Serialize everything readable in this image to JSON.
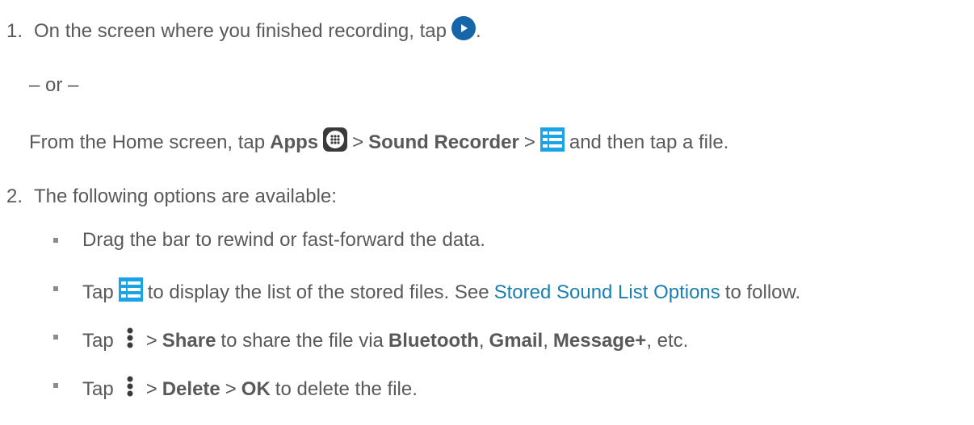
{
  "step1": {
    "number": "1.",
    "text_before": "On the screen where you finished recording, tap",
    "text_after": ".",
    "play_icon": "play-icon",
    "or_text": "– or –",
    "alt": {
      "t1": "From the Home screen, tap",
      "apps": "Apps",
      "sep1": ">",
      "sound_recorder": "Sound Recorder",
      "sep2": ">",
      "t2": "and then tap a file.",
      "apps_icon": "apps-grid-icon",
      "list_icon": "list-icon"
    }
  },
  "step2": {
    "number": "2.",
    "text": "The following options are available:",
    "bullets": [
      {
        "text": "Drag the bar to rewind or fast-forward the data."
      },
      {
        "t1": "Tap",
        "t2": "to display the list of the stored files. See",
        "link": "Stored Sound List Options",
        "t3": "to follow."
      },
      {
        "t1": "Tap",
        "sep": ">",
        "share": "Share",
        "t2": "to share the file via",
        "bluetooth": "Bluetooth",
        "c1": ",",
        "gmail": "Gmail",
        "c2": ",",
        "message": "Message+",
        "t3": ", etc."
      },
      {
        "t1": "Tap",
        "sep1": ">",
        "delete": "Delete",
        "sep2": ">",
        "ok": "OK",
        "t2": "to delete the file."
      }
    ]
  },
  "colors": {
    "text": "#595959",
    "link": "#1a7fb0",
    "play_circle": "#1565a8",
    "list_icon": "#1aa3e8",
    "apps_icon": "#3a3a3a"
  }
}
